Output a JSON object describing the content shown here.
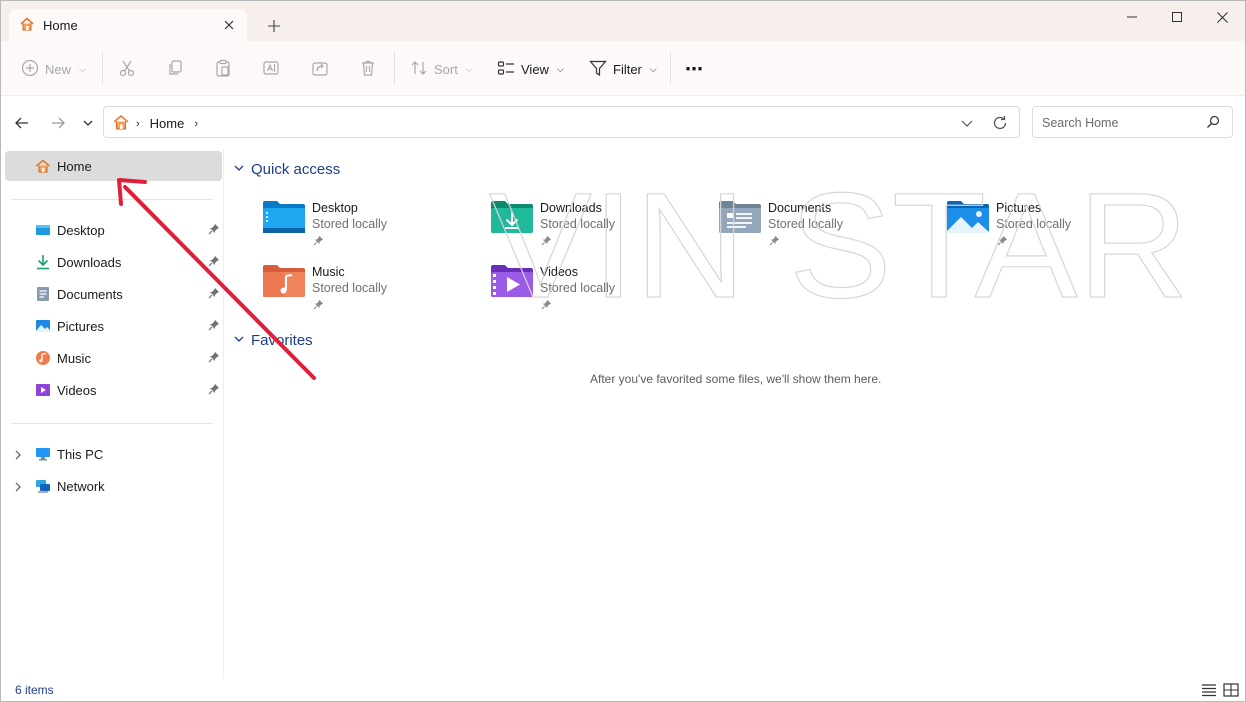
{
  "window": {
    "tab_title": "Home",
    "accent": "#1f3c88",
    "annotation_color": "#e0203a"
  },
  "toolbar": {
    "new_label": "New",
    "sort_label": "Sort",
    "view_label": "View",
    "filter_label": "Filter",
    "more_label": "⋯"
  },
  "address": {
    "crumb": "Home",
    "search_placeholder": "Search Home"
  },
  "sidebar": {
    "home": "Home",
    "pinned": [
      {
        "label": "Desktop",
        "icon": "desktop-icon"
      },
      {
        "label": "Downloads",
        "icon": "downloads-icon"
      },
      {
        "label": "Documents",
        "icon": "documents-icon"
      },
      {
        "label": "Pictures",
        "icon": "pictures-icon"
      },
      {
        "label": "Music",
        "icon": "music-icon"
      },
      {
        "label": "Videos",
        "icon": "videos-icon"
      }
    ],
    "this_pc": "This PC",
    "network": "Network"
  },
  "main": {
    "quick_access_title": "Quick access",
    "quick_access": [
      {
        "name": "Desktop",
        "sub": "Stored locally"
      },
      {
        "name": "Downloads",
        "sub": "Stored locally"
      },
      {
        "name": "Documents",
        "sub": "Stored locally"
      },
      {
        "name": "Pictures",
        "sub": "Stored locally"
      },
      {
        "name": "Music",
        "sub": "Stored locally"
      },
      {
        "name": "Videos",
        "sub": "Stored locally"
      }
    ],
    "favorites_title": "Favorites",
    "favorites_empty": "After you've favorited some files, we'll show them here.",
    "watermark": "VIN STAR"
  },
  "status": {
    "items_count": "6 items"
  }
}
